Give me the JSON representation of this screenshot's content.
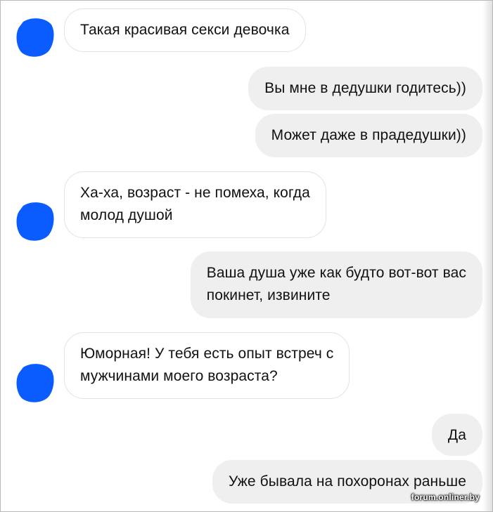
{
  "messages": [
    {
      "sender": "them",
      "text": "Такая красивая секси девочка"
    },
    {
      "sender": "me",
      "text": "Вы мне в дедушки годитесь))"
    },
    {
      "sender": "me",
      "text": "Может даже в прадедушки))"
    },
    {
      "sender": "them",
      "lines": [
        "Ха-ха, возраст - не помеха, когда",
        "молод душой"
      ]
    },
    {
      "sender": "me",
      "lines": [
        "Ваша душа уже как будто вот-вот вас",
        "покинет, извините"
      ]
    },
    {
      "sender": "them",
      "lines": [
        "Юморная! У тебя есть опыт встреч с",
        "мужчинами моего возраста?"
      ]
    },
    {
      "sender": "me",
      "text": "Да"
    },
    {
      "sender": "me",
      "text": "Уже бывала на похоронах раньше"
    }
  ],
  "avatar": {
    "icon": "blue-scribble-avatar",
    "color": "#0a5cff"
  },
  "colors": {
    "incoming_bubble": "#ffffff",
    "outgoing_bubble": "#efefef",
    "text": "#111111"
  },
  "watermark": "forum.onliner.by"
}
